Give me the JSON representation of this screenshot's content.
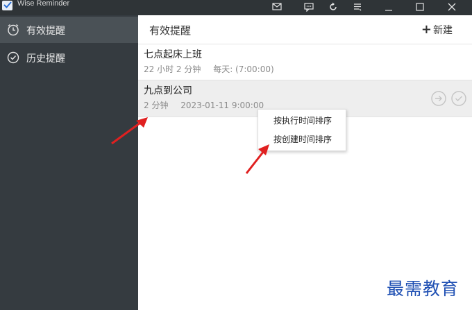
{
  "window": {
    "title": "Wise Reminder"
  },
  "titlebar_buttons": [
    {
      "name": "mail-icon"
    },
    {
      "name": "chat-icon"
    },
    {
      "name": "refresh-icon"
    },
    {
      "name": "menu-icon"
    },
    {
      "name": "minimize-icon"
    },
    {
      "name": "maximize-icon"
    },
    {
      "name": "close-icon"
    }
  ],
  "sidebar": {
    "items": [
      {
        "label": "有效提醒",
        "icon": "clock-icon",
        "active": true
      },
      {
        "label": "历史提醒",
        "icon": "check-circle-icon",
        "active": false
      }
    ]
  },
  "main": {
    "title": "有效提醒",
    "new_label": "新建",
    "reminders": [
      {
        "name": "七点起床上班",
        "countdown": "22 小时  2 分钟",
        "schedule": "每天: (7:00:00)"
      },
      {
        "name": "九点到公司",
        "countdown": "2 分钟",
        "schedule": "2023-01-11 9:00:00"
      }
    ]
  },
  "context_menu": {
    "items": [
      "按执行时间排序",
      "按创建时间排序"
    ]
  },
  "watermark": "最需教育",
  "colors": {
    "titlebar": "#2f3437",
    "sidebar": "#353b40",
    "sidebar_active": "#4a5156",
    "annotation_arrow": "#e02020",
    "watermark": "#1e4fb3"
  }
}
